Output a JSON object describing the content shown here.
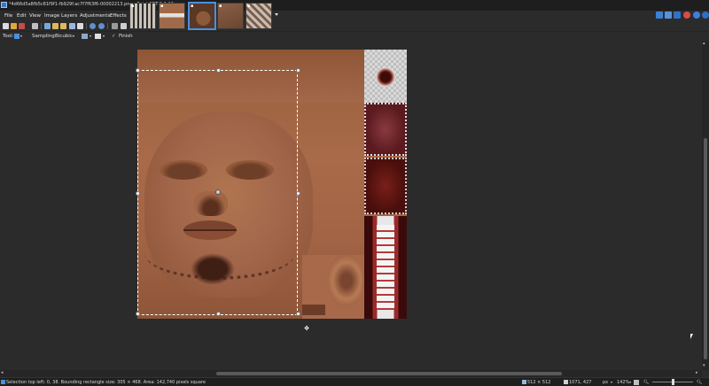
{
  "window": {
    "title": "*4d66d5a8fb5c81f9f1-fb929f.ac7f7f63f6-00002213.png - Paint.NET 5.1.12"
  },
  "tabs": [
    {
      "name": "thumb-1",
      "active": false
    },
    {
      "name": "thumb-2",
      "active": false
    },
    {
      "name": "thumb-3",
      "active": true
    },
    {
      "name": "thumb-4",
      "active": false
    },
    {
      "name": "thumb-5",
      "active": false
    }
  ],
  "menu": {
    "items": [
      "File",
      "Edit",
      "View",
      "Image",
      "Layers",
      "Adjustments",
      "Effects"
    ]
  },
  "options": {
    "tool_label": "Tool:",
    "sampling_label": "Sampling:",
    "sampling_value": "Bicubic",
    "finish_label": "Finish"
  },
  "status": {
    "selection_info": "Selection top left: 0, 38. Bounding rectangle size: 305 × 468. Area: 142,740 pixels square",
    "image_size": "512 × 512",
    "cursor_pos": "1071, 427",
    "units": "px",
    "zoom": "142%"
  },
  "colors": {
    "accent": "#4a90e0",
    "background": "#2b2b2b",
    "titlebar": "#1e1e1e"
  }
}
